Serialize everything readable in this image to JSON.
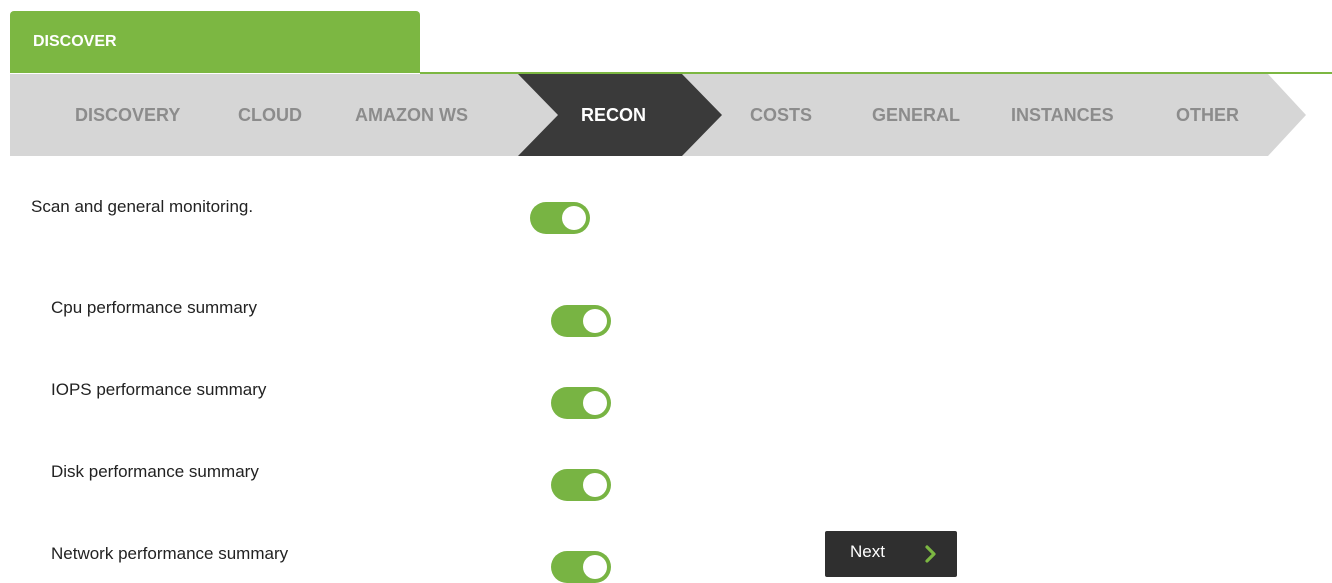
{
  "tab": {
    "title": "DISCOVER"
  },
  "breadcrumbs": [
    {
      "label": "DISCOVERY",
      "active": false
    },
    {
      "label": "CLOUD",
      "active": false
    },
    {
      "label": "AMAZON WS",
      "active": false
    },
    {
      "label": "RECON",
      "active": true
    },
    {
      "label": "COSTS",
      "active": false
    },
    {
      "label": "GENERAL",
      "active": false
    },
    {
      "label": "INSTANCES",
      "active": false
    },
    {
      "label": "OTHER",
      "active": false
    }
  ],
  "settings": {
    "main": {
      "label": "Scan and general monitoring.",
      "enabled": true
    },
    "items": [
      {
        "label": "Cpu performance summary",
        "enabled": true
      },
      {
        "label": "IOPS performance summary",
        "enabled": true
      },
      {
        "label": "Disk performance summary",
        "enabled": true
      },
      {
        "label": "Network performance summary",
        "enabled": true
      }
    ]
  },
  "next_button": {
    "label": "Next",
    "icon": "chevron-right-icon"
  },
  "colors": {
    "accent_green": "#7cb742",
    "toggle_green": "#78b443",
    "breadcrumb_bg": "#d6d6d6",
    "breadcrumb_active": "#3a3a3a",
    "breadcrumb_text": "#8c8c8c"
  }
}
